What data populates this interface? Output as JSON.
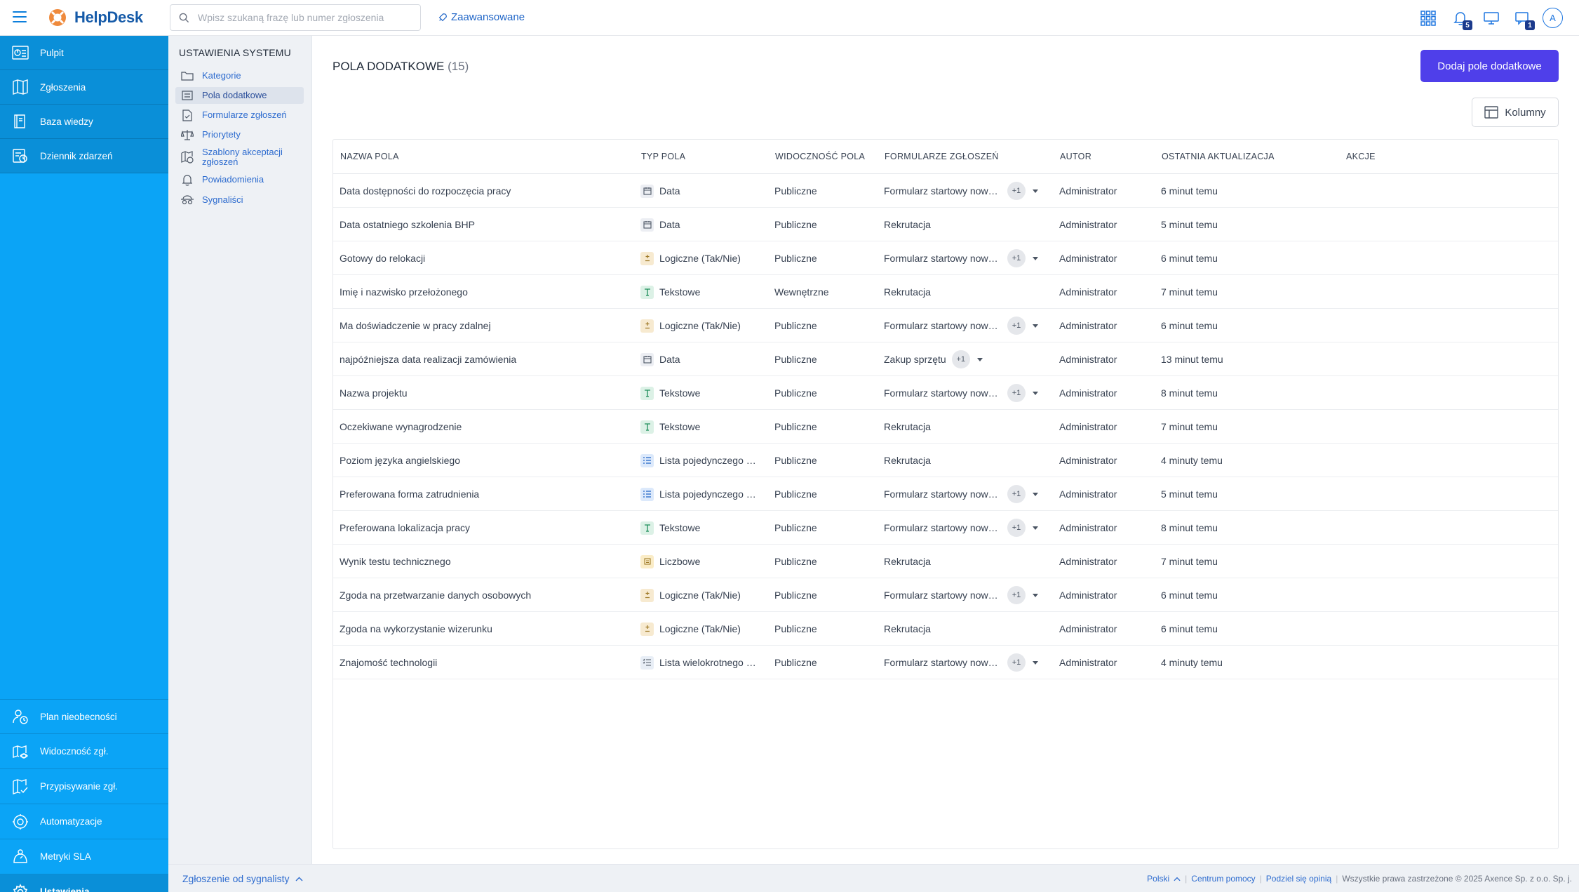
{
  "app": {
    "name": "HelpDesk"
  },
  "search": {
    "placeholder": "Wpisz szukaną frazę lub numer zgłoszenia",
    "advanced_label": "Zaawansowane"
  },
  "topbar": {
    "notifications_badge": "5",
    "chat_badge": "1",
    "avatar_initial": "A"
  },
  "sidebar": {
    "top_items": [
      {
        "label": "Pulpit",
        "icon": "dashboard-icon"
      },
      {
        "label": "Zgłoszenia",
        "icon": "tickets-icon"
      },
      {
        "label": "Baza wiedzy",
        "icon": "book-icon"
      },
      {
        "label": "Dziennik zdarzeń",
        "icon": "log-icon"
      }
    ],
    "bottom_items": [
      {
        "label": "Plan nieobecności",
        "icon": "absence-icon"
      },
      {
        "label": "Widoczność zgł.",
        "icon": "visibility-icon"
      },
      {
        "label": "Przypisywanie zgł.",
        "icon": "assign-icon"
      },
      {
        "label": "Automatyzacje",
        "icon": "automation-icon"
      },
      {
        "label": "Metryki SLA",
        "icon": "sla-icon"
      },
      {
        "label": "Ustawienia",
        "icon": "gear-icon"
      }
    ]
  },
  "settings_nav": {
    "title": "USTAWIENIA SYSTEMU",
    "items": [
      {
        "label": "Kategorie",
        "icon": "folder-icon"
      },
      {
        "label": "Pola dodatkowe",
        "icon": "fields-icon"
      },
      {
        "label": "Formularze zgłoszeń",
        "icon": "form-icon"
      },
      {
        "label": "Priorytety",
        "icon": "scale-icon"
      },
      {
        "label": "Szablony akceptacji zgłoszeń",
        "icon": "approval-template-icon"
      },
      {
        "label": "Powiadomienia",
        "icon": "bell-icon"
      },
      {
        "label": "Sygnaliści",
        "icon": "whistleblower-icon"
      }
    ]
  },
  "main": {
    "title": "POLA DODATKOWE",
    "count": "(15)",
    "add_button": "Dodaj pole dodatkowe",
    "columns_button": "Kolumny"
  },
  "table": {
    "headers": {
      "name": "NAZWA POLA",
      "type": "TYP POLA",
      "visibility": "WIDOCZNOŚĆ POLA",
      "forms": "FORMULARZE ZGŁOSZEŃ",
      "author": "AUTOR",
      "updated": "OSTATNIA AKTUALIZACJA",
      "actions": "AKCJE"
    },
    "rows": [
      {
        "name": "Data dostępności do rozpoczęcia pracy",
        "type": "Data",
        "type_icon": "calendar-icon",
        "visibility": "Publiczne",
        "form": "Formularz startowy nowego pracownika",
        "more": "+1",
        "author": "Administrator",
        "updated": "6 minut temu"
      },
      {
        "name": "Data ostatniego szkolenia BHP",
        "type": "Data",
        "type_icon": "calendar-icon",
        "visibility": "Publiczne",
        "form": "Rekrutacja",
        "more": "",
        "author": "Administrator",
        "updated": "5 minut temu"
      },
      {
        "name": "Gotowy do relokacji",
        "type": "Logiczne (Tak/Nie)",
        "type_icon": "plus-minus-icon",
        "visibility": "Publiczne",
        "form": "Formularz startowy nowego pracownika",
        "more": "+1",
        "author": "Administrator",
        "updated": "6 minut temu"
      },
      {
        "name": "Imię i nazwisko przełożonego",
        "type": "Tekstowe",
        "type_icon": "text-icon",
        "visibility": "Wewnętrzne",
        "form": "Rekrutacja",
        "more": "",
        "author": "Administrator",
        "updated": "7 minut temu"
      },
      {
        "name": "Ma doświadczenie w pracy zdalnej",
        "type": "Logiczne (Tak/Nie)",
        "type_icon": "plus-minus-icon",
        "visibility": "Publiczne",
        "form": "Formularz startowy nowego pracownika",
        "more": "+1",
        "author": "Administrator",
        "updated": "6 minut temu"
      },
      {
        "name": "najpóźniejsza data realizacji zamówienia",
        "type": "Data",
        "type_icon": "calendar-icon",
        "visibility": "Publiczne",
        "form": "Zakup sprzętu",
        "more": "+1",
        "author": "Administrator",
        "updated": "13 minut temu"
      },
      {
        "name": "Nazwa projektu",
        "type": "Tekstowe",
        "type_icon": "text-icon",
        "visibility": "Publiczne",
        "form": "Formularz startowy nowego pracownika",
        "more": "+1",
        "author": "Administrator",
        "updated": "8 minut temu"
      },
      {
        "name": "Oczekiwane wynagrodzenie",
        "type": "Tekstowe",
        "type_icon": "text-icon",
        "visibility": "Publiczne",
        "form": "Rekrutacja",
        "more": "",
        "author": "Administrator",
        "updated": "7 minut temu"
      },
      {
        "name": "Poziom języka angielskiego",
        "type": "Lista pojedynczego wyboru",
        "type_icon": "list-icon",
        "visibility": "Publiczne",
        "form": "Rekrutacja",
        "more": "",
        "author": "Administrator",
        "updated": "4 minuty temu"
      },
      {
        "name": "Preferowana forma zatrudnienia",
        "type": "Lista pojedynczego wyboru",
        "type_icon": "list-icon",
        "visibility": "Publiczne",
        "form": "Formularz startowy nowego pracownika",
        "more": "+1",
        "author": "Administrator",
        "updated": "5 minut temu"
      },
      {
        "name": "Preferowana lokalizacja pracy",
        "type": "Tekstowe",
        "type_icon": "text-icon",
        "visibility": "Publiczne",
        "form": "Formularz startowy nowego pracownika",
        "more": "+1",
        "author": "Administrator",
        "updated": "8 minut temu"
      },
      {
        "name": "Wynik testu technicznego",
        "type": "Liczbowe",
        "type_icon": "number-icon",
        "visibility": "Publiczne",
        "form": "Rekrutacja",
        "more": "",
        "author": "Administrator",
        "updated": "7 minut temu"
      },
      {
        "name": "Zgoda na przetwarzanie danych osobowych",
        "type": "Logiczne (Tak/Nie)",
        "type_icon": "plus-minus-icon",
        "visibility": "Publiczne",
        "form": "Formularz startowy nowego pracownika",
        "more": "+1",
        "author": "Administrator",
        "updated": "6 minut temu"
      },
      {
        "name": "Zgoda na wykorzystanie wizerunku",
        "type": "Logiczne (Tak/Nie)",
        "type_icon": "plus-minus-icon",
        "visibility": "Publiczne",
        "form": "Rekrutacja",
        "more": "",
        "author": "Administrator",
        "updated": "6 minut temu"
      },
      {
        "name": "Znajomość technologii",
        "type": "Lista wielokrotnego wyboru",
        "type_icon": "multi-list-icon",
        "visibility": "Publiczne",
        "form": "Formularz startowy nowego pracownika",
        "more": "+1",
        "author": "Administrator",
        "updated": "4 minuty temu"
      }
    ]
  },
  "footer": {
    "whistleblower_link": "Zgłoszenie od sygnalisty",
    "language": "Polski",
    "help": "Centrum pomocy",
    "feedback": "Podziel się opinią",
    "copyright": "Wszystkie prawa zastrzeżone © 2025 Axence Sp. z o.o. Sp. j."
  },
  "colors": {
    "sidebar": "#0ba4f6",
    "primary_button": "#4f3fea",
    "link": "#2e6ccf"
  }
}
